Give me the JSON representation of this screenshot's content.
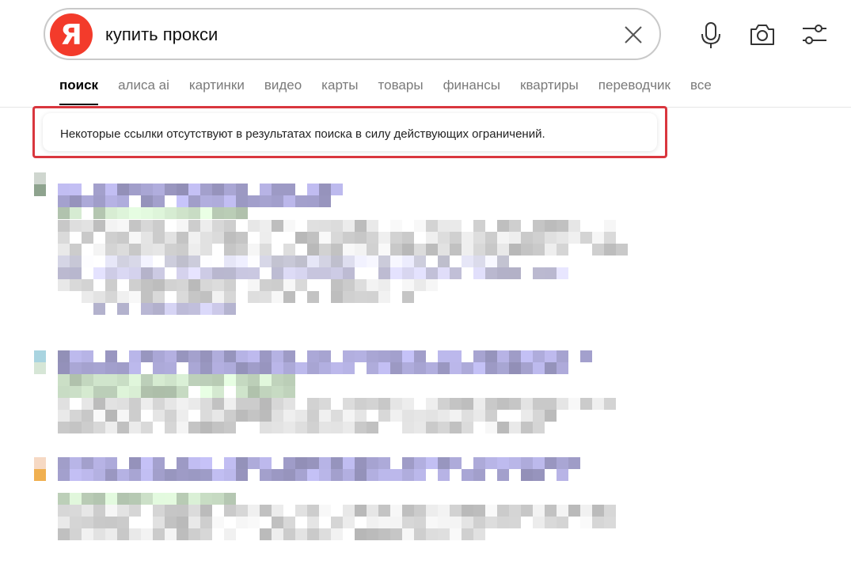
{
  "search": {
    "logo_letter": "Я",
    "query": "купить прокси"
  },
  "tabs": [
    {
      "label": "поиск",
      "active": true
    },
    {
      "label": "алиса ai",
      "active": false
    },
    {
      "label": "картинки",
      "active": false
    },
    {
      "label": "видео",
      "active": false
    },
    {
      "label": "карты",
      "active": false
    },
    {
      "label": "товары",
      "active": false
    },
    {
      "label": "финансы",
      "active": false
    },
    {
      "label": "квартиры",
      "active": false
    },
    {
      "label": "переводчик",
      "active": false
    },
    {
      "label": "все",
      "active": false
    }
  ],
  "notice": {
    "text": "Некоторые ссылки отсутствуют в результатах поиска в силу действующих ограничений."
  },
  "colors": {
    "brand": "#f33b2b",
    "notice_border": "#d9363e",
    "link_blur": "#a9a6d4",
    "text_blur": "#d4d4d4",
    "url_blur": "#c8dcc4"
  },
  "icons": {
    "clear": "close-icon",
    "voice": "microphone-icon",
    "camera": "camera-icon",
    "settings": "settings-sliders-icon"
  }
}
